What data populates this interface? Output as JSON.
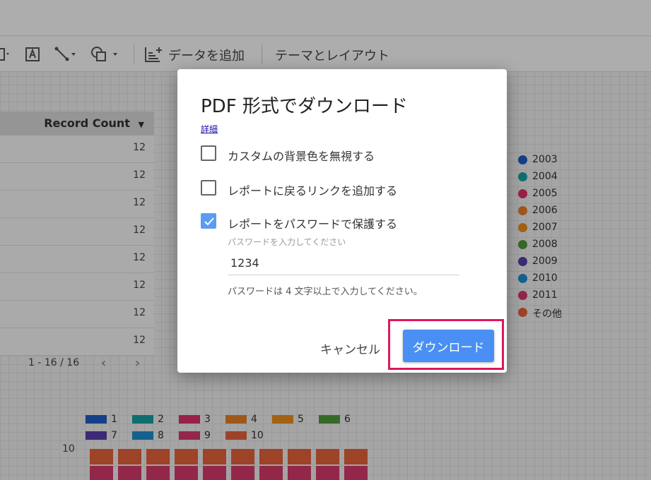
{
  "toolbar": {
    "add_data_label": "データを追加",
    "theme_label": "テーマとレイアウト"
  },
  "table": {
    "header": "Record Count",
    "values": [
      "12",
      "12",
      "12",
      "12",
      "12",
      "12",
      "12",
      "12"
    ],
    "pager": "1 - 16 / 16"
  },
  "legend": [
    {
      "label": "2003",
      "color": "#1f5fc9"
    },
    {
      "label": "2004",
      "color": "#16a3a3"
    },
    {
      "label": "2005",
      "color": "#e1306c"
    },
    {
      "label": "2006",
      "color": "#e8822a"
    },
    {
      "label": "2007",
      "color": "#f0901c"
    },
    {
      "label": "2008",
      "color": "#4f9b3b"
    },
    {
      "label": "2009",
      "color": "#5a3fb0"
    },
    {
      "label": "2010",
      "color": "#1f8fd1"
    },
    {
      "label": "2011",
      "color": "#d93a6e"
    },
    {
      "label": "その他",
      "color": "#e8643a"
    }
  ],
  "bottom_legend": [
    {
      "label": "1",
      "color": "#1f5fc9"
    },
    {
      "label": "2",
      "color": "#16a3a3"
    },
    {
      "label": "3",
      "color": "#e1306c"
    },
    {
      "label": "4",
      "color": "#e8822a"
    },
    {
      "label": "5",
      "color": "#f0901c"
    },
    {
      "label": "6",
      "color": "#4f9b3b"
    },
    {
      "label": "7",
      "color": "#5a3fb0"
    },
    {
      "label": "8",
      "color": "#1f8fd1"
    },
    {
      "label": "9",
      "color": "#d93a6e"
    },
    {
      "label": "10",
      "color": "#e8643a"
    }
  ],
  "bottom_chart": {
    "y_tick": "10"
  },
  "dialog": {
    "title": "PDF 形式でダウンロード",
    "details_link": "詳細",
    "options": [
      {
        "label": "カスタムの背景色を無視する",
        "checked": false
      },
      {
        "label": "レポートに戻るリンクを追加する",
        "checked": false
      },
      {
        "label": "レポートをパスワードで保護する",
        "checked": true
      }
    ],
    "password_label": "パスワードを入力してください",
    "password_value": "1234",
    "password_hint": "パスワードは 4 文字以上で入力してください。",
    "cancel_label": "キャンセル",
    "download_label": "ダウンロード"
  }
}
